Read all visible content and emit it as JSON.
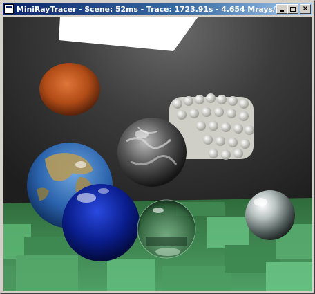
{
  "window": {
    "title": "MiniRayTracer - Scene: 52ms - Trace: 1723.91s - 4.654 Mrays/s |...",
    "close_glyph": "×",
    "title_icon": "app-window-icon"
  },
  "scene": {
    "description_objects": [
      "ceiling-light",
      "orange-sphere",
      "marble-sphere",
      "white-sphere-cluster",
      "earth-sphere",
      "blue-sphere",
      "glass-sphere",
      "chrome-sphere",
      "green-block-floor"
    ],
    "colors": {
      "background": "#2e2e2e",
      "floor": "#3f8a4f",
      "light": "#ffffff",
      "orange_sphere": "#c8581c",
      "blue_sphere": "#0a1d8c",
      "earth_ocean": "#2e6fb8",
      "earth_land": "#b59a5a"
    }
  }
}
